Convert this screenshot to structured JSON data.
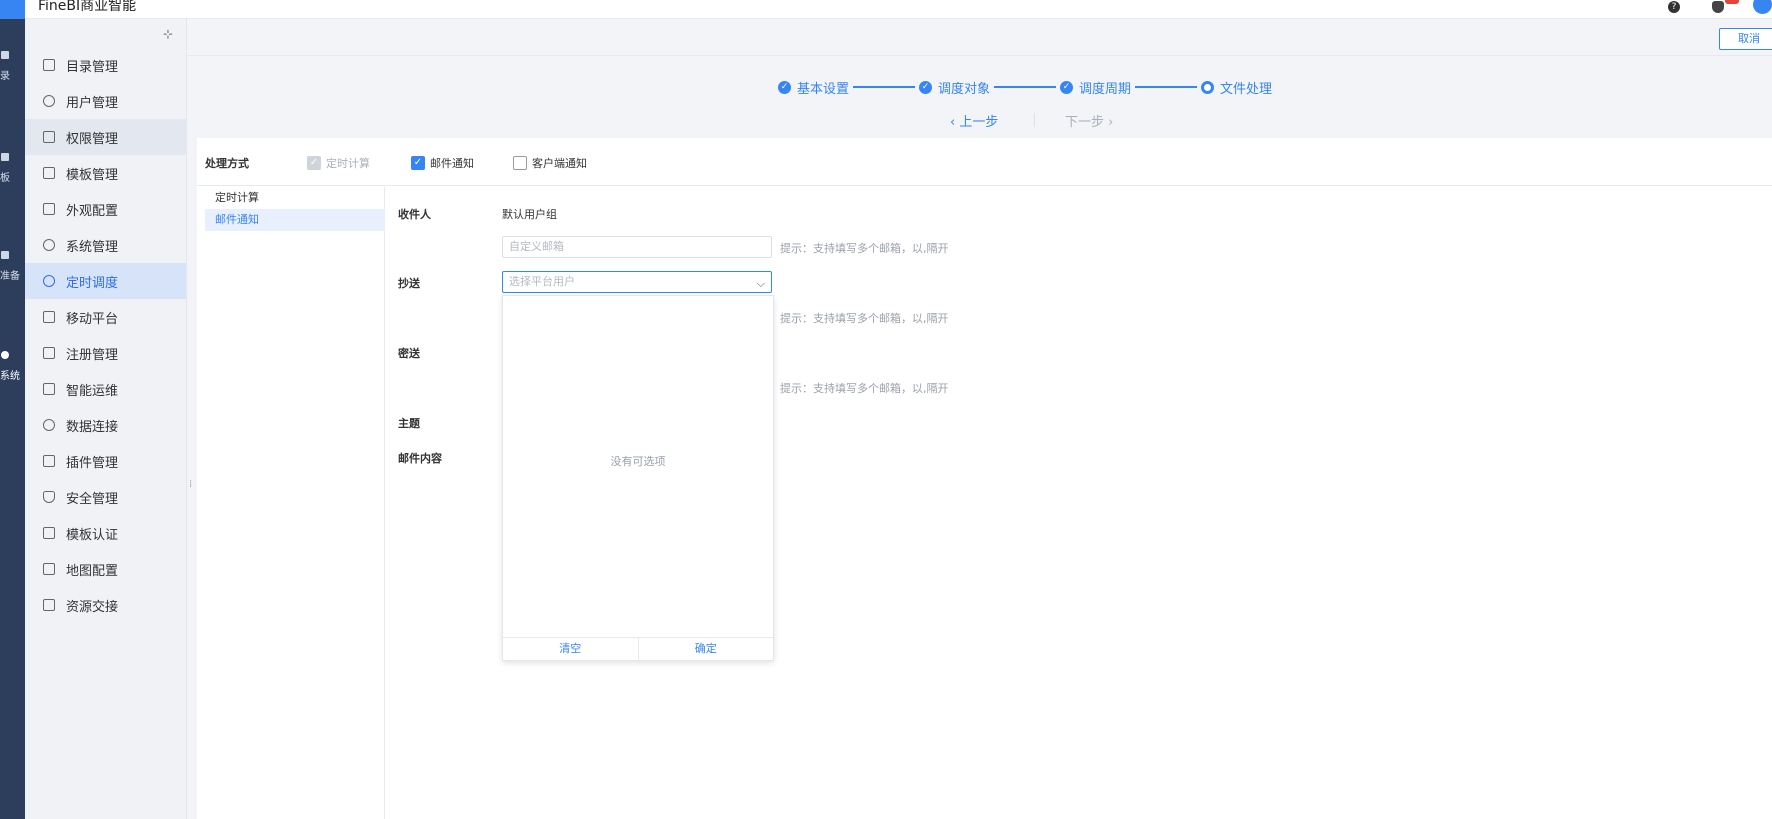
{
  "app": {
    "title": "FineBI商业智能",
    "brand_color": "#3685f2"
  },
  "header": {
    "cancel_label": "取消",
    "help_icon": "question-icon",
    "bell_icon": "bell-icon"
  },
  "rail": {
    "items": [
      {
        "icon": "catalog-icon",
        "label": "录"
      },
      {
        "icon": "dashboard-icon",
        "label": "板"
      },
      {
        "icon": "data-prep-icon",
        "label": "准备"
      },
      {
        "icon": "system-gear-icon",
        "label": "系统"
      }
    ]
  },
  "sidebar": {
    "items": [
      {
        "label": "目录管理",
        "icon": "catalog-icon"
      },
      {
        "label": "用户管理",
        "icon": "user-icon"
      },
      {
        "label": "权限管理",
        "icon": "lock-icon"
      },
      {
        "label": "模板管理",
        "icon": "template-icon"
      },
      {
        "label": "外观配置",
        "icon": "brush-icon"
      },
      {
        "label": "系统管理",
        "icon": "gear-icon"
      },
      {
        "label": "定时调度",
        "icon": "clock-icon"
      },
      {
        "label": "移动平台",
        "icon": "mobile-icon"
      },
      {
        "label": "注册管理",
        "icon": "register-icon"
      },
      {
        "label": "智能运维",
        "icon": "ops-icon"
      },
      {
        "label": "数据连接",
        "icon": "link-icon"
      },
      {
        "label": "插件管理",
        "icon": "plugin-icon"
      },
      {
        "label": "安全管理",
        "icon": "shield-icon"
      },
      {
        "label": "模板认证",
        "icon": "certify-icon"
      },
      {
        "label": "地图配置",
        "icon": "map-icon"
      },
      {
        "label": "资源交接",
        "icon": "transfer-icon"
      }
    ],
    "active_index": 6,
    "hover_index": 2
  },
  "wizard": {
    "steps": [
      {
        "label": "基本设置",
        "state": "done"
      },
      {
        "label": "调度对象",
        "state": "done"
      },
      {
        "label": "调度周期",
        "state": "done"
      },
      {
        "label": "文件处理",
        "state": "current"
      }
    ],
    "prev_label": "上一步",
    "next_label": "下一步"
  },
  "processing": {
    "label": "处理方式",
    "options": [
      {
        "label": "定时计算",
        "checked": true,
        "disabled": true
      },
      {
        "label": "邮件通知",
        "checked": true,
        "disabled": false
      },
      {
        "label": "客户端通知",
        "checked": false,
        "disabled": false
      }
    ],
    "list": [
      {
        "label": "定时计算",
        "active": false
      },
      {
        "label": "邮件通知",
        "active": true
      }
    ]
  },
  "form": {
    "recipient_label": "收件人",
    "recipient_value": "默认用户组",
    "custom_email_placeholder": "自定义邮箱",
    "hint": "提示：支持填写多个邮箱，以,隔开",
    "cc_label": "抄送",
    "cc_select_placeholder": "选择平台用户",
    "bcc_label": "密送",
    "subject_label": "主题",
    "content_label": "邮件内容"
  },
  "dropdown": {
    "empty_text": "没有可选项",
    "clear_label": "清空",
    "confirm_label": "确定"
  }
}
